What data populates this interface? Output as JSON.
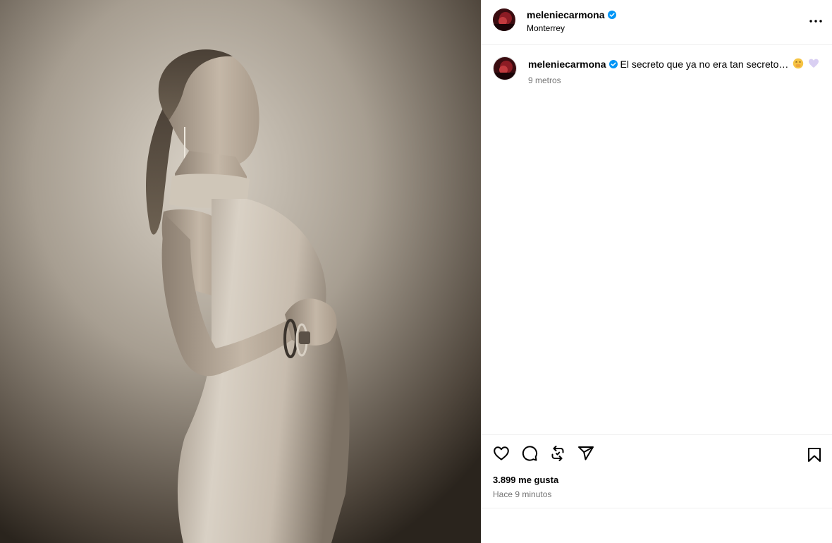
{
  "post": {
    "author": {
      "username": "meleniecarmona",
      "location": "Monterrey",
      "verified": true
    },
    "caption": {
      "username": "meleniecarmona",
      "text": "El secreto que ya no era tan secreto…",
      "emojis": [
        "face-with-hand-over-mouth",
        "light-purple-heart"
      ],
      "time": "9 metros"
    },
    "actions": [
      "like-icon",
      "comment-icon",
      "repost-icon",
      "share-icon",
      "save-icon"
    ],
    "likes_text": "3.899 me gusta",
    "posted_time": "Hace 9 minutos"
  },
  "colors": {
    "verified_badge": "#0095f6",
    "muted_text": "#737373",
    "divider": "#efefef"
  }
}
